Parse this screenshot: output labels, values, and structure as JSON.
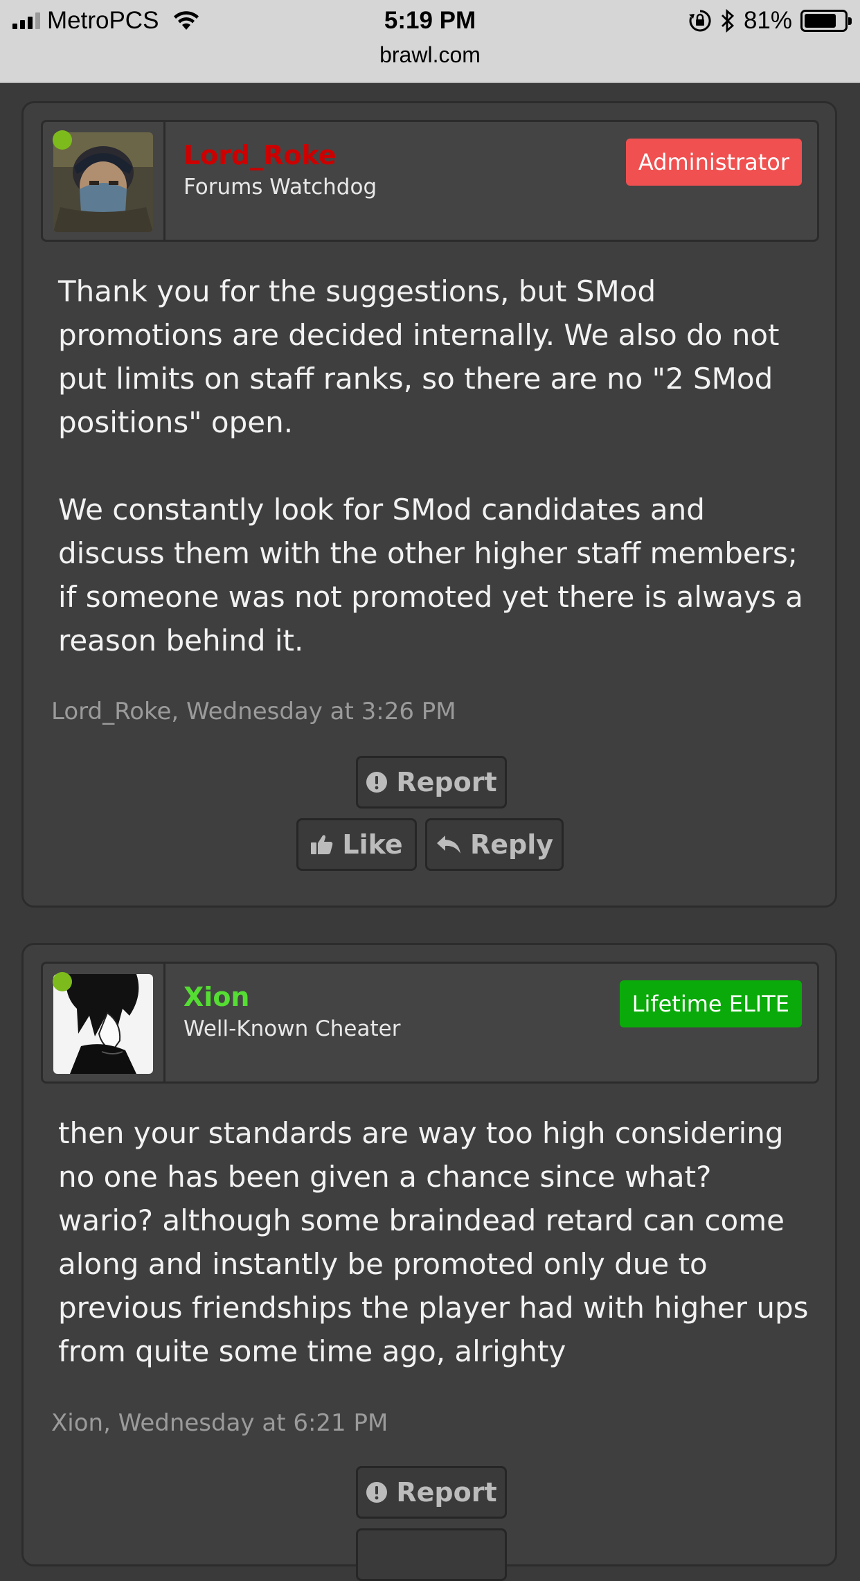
{
  "status_bar": {
    "carrier": "MetroPCS",
    "time": "5:19 PM",
    "url": "brawl.com",
    "battery": "81%",
    "battery_level": 0.81,
    "icons": [
      "signal-icon",
      "wifi-icon",
      "rotation-lock-icon",
      "bluetooth-icon",
      "battery-icon"
    ]
  },
  "posts": [
    {
      "username": "Lord_Roke",
      "username_color": "#cc0000",
      "user_title": "Forums Watchdog",
      "badge": "Administrator",
      "badge_color": "#f05050",
      "online": true,
      "message": "Thank you for the suggestions, but SMod promotions are decided internally. We also do not put limits on staff ranks, so there are no \"2 SMod positions\" open.\n\nWe constantly look for SMod candidates and discuss them with the other higher staff members; if someone was not promoted yet there is always a reason behind it.",
      "meta": "Lord_Roke, Wednesday at 3:26 PM",
      "actions": {
        "report": "Report",
        "like": "Like",
        "reply": "Reply"
      }
    },
    {
      "username": "Xion",
      "username_color": "#55dd33",
      "user_title": "Well-Known Cheater",
      "badge": "Lifetime ELITE",
      "badge_color": "#0aaa0a",
      "online": true,
      "message": "then your standards are way too high considering no one has been given a chance since what? wario? although some braindead retard can come along and instantly be promoted only due to previous friendships the player had with higher ups from quite some time ago, alrighty",
      "meta": "Xion, Wednesday at 6:21 PM",
      "actions": {
        "report": "Report"
      }
    }
  ]
}
